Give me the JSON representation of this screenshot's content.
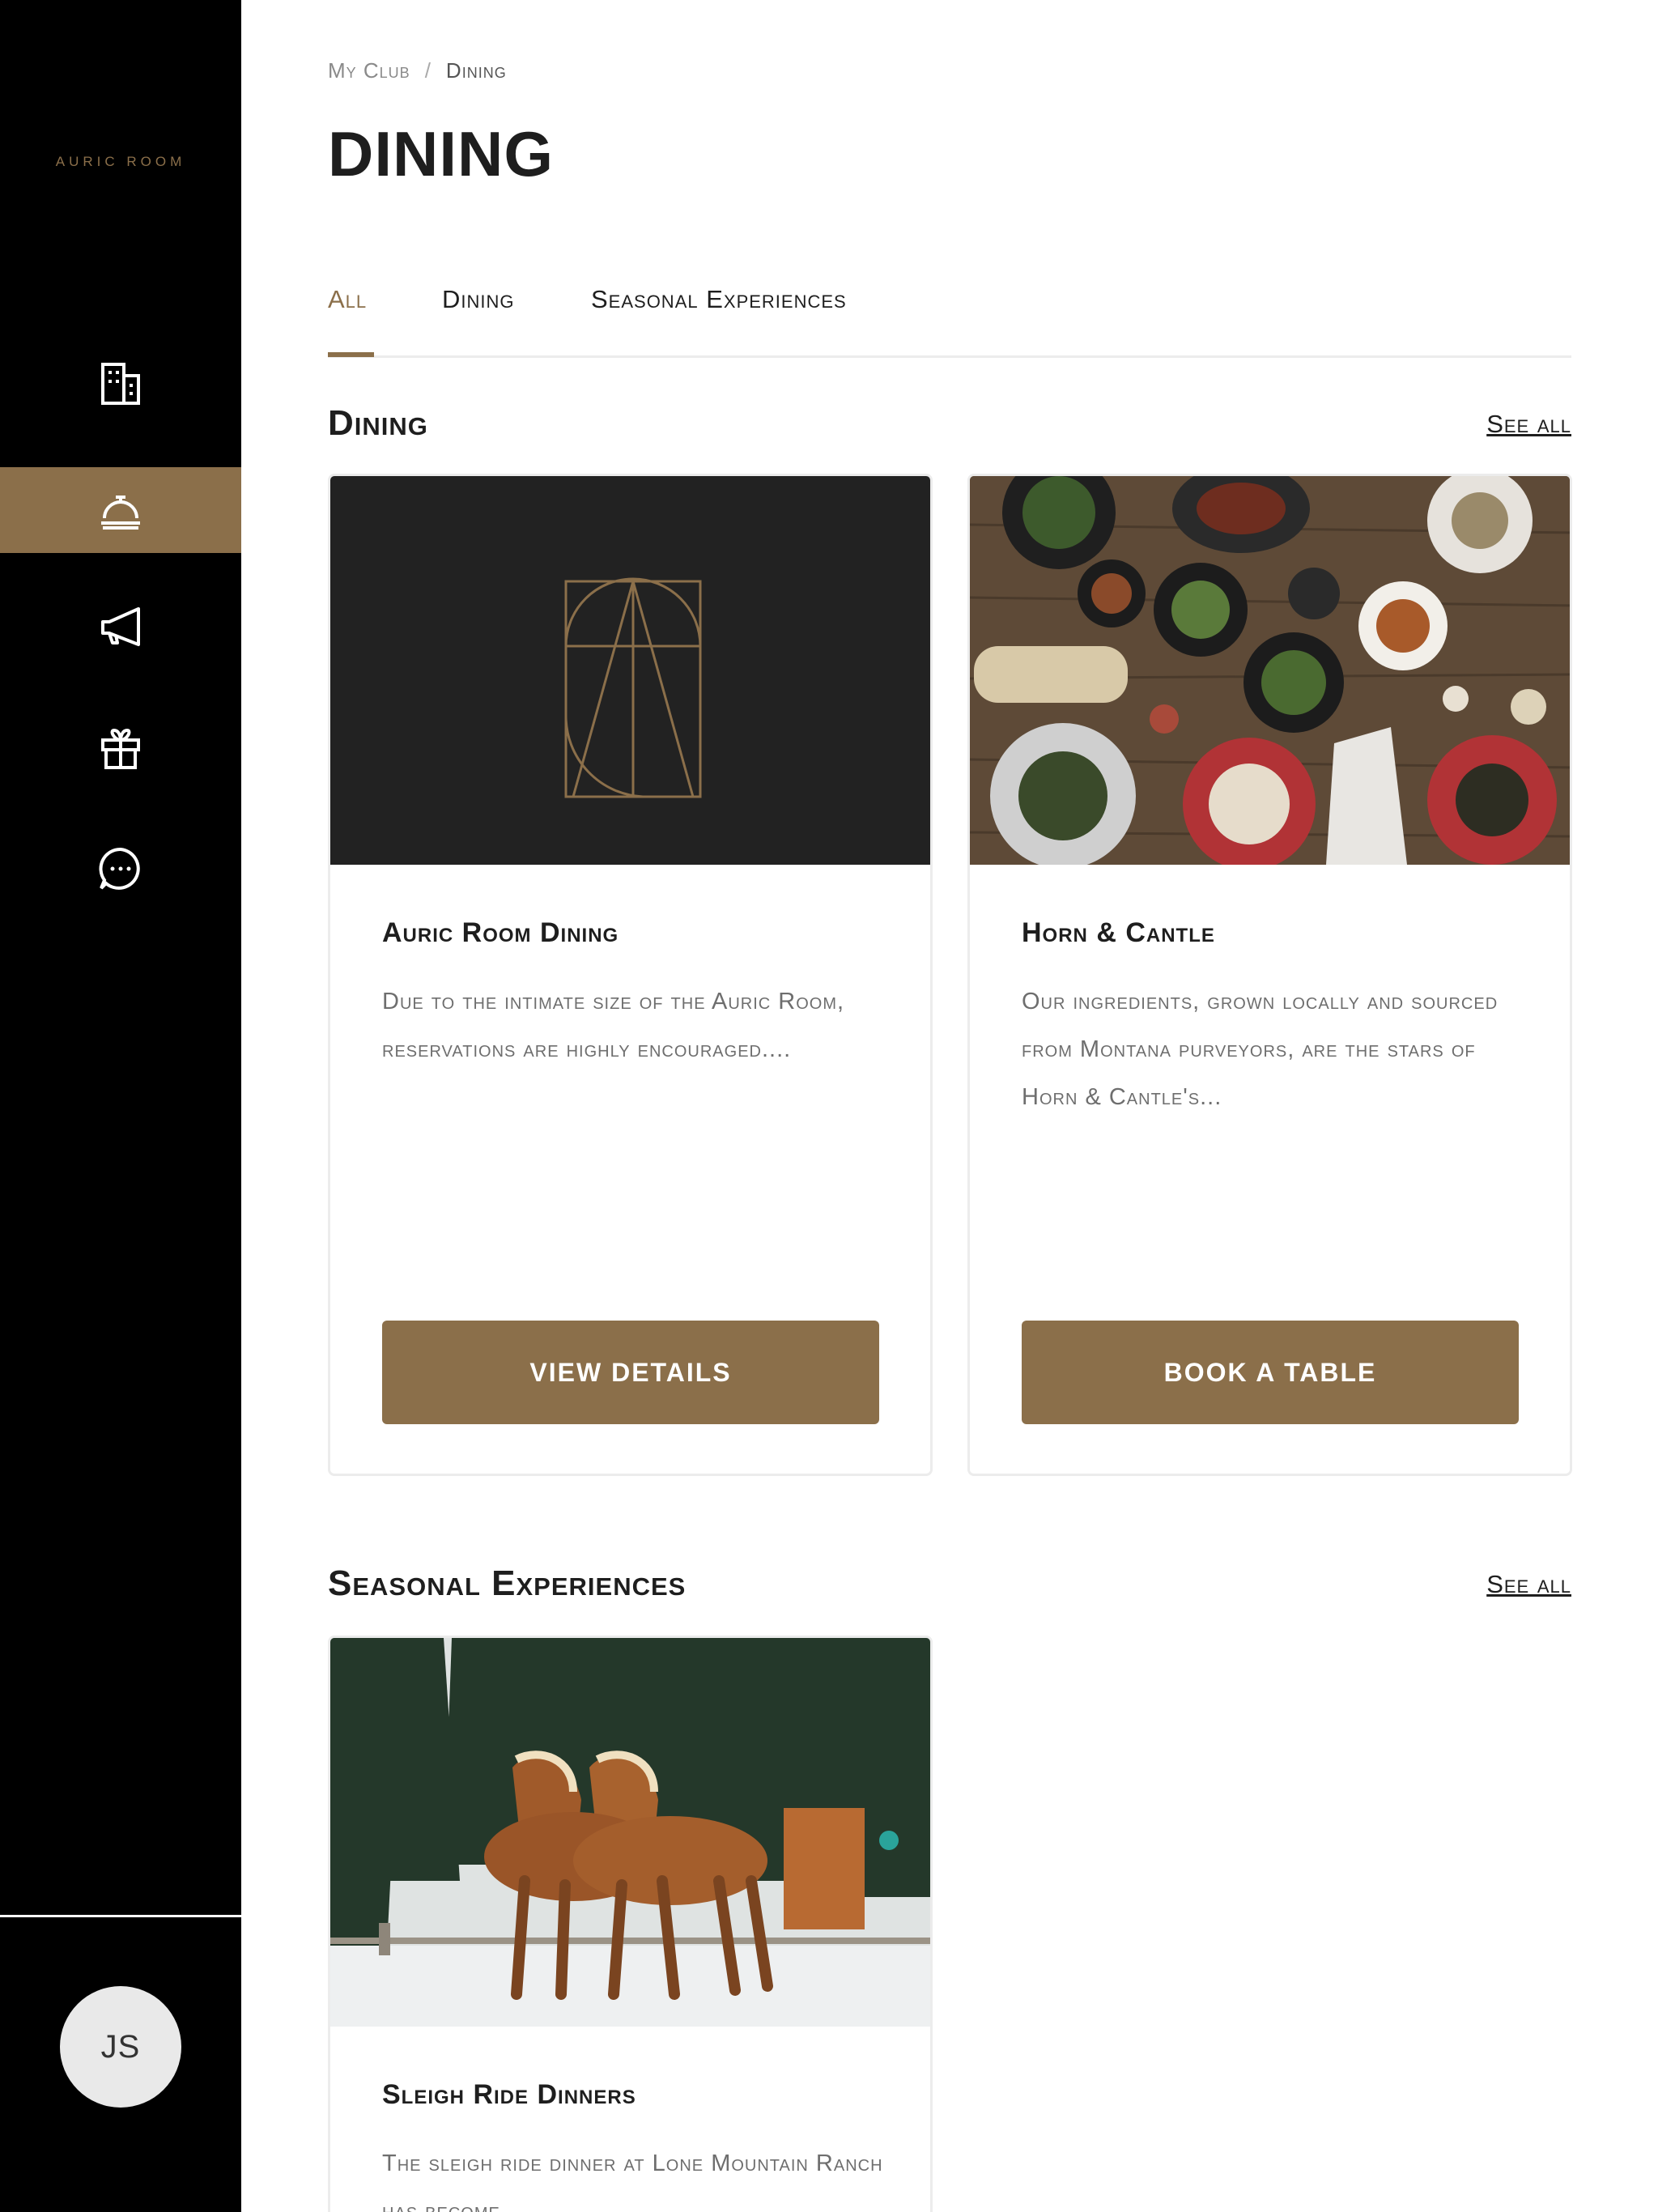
{
  "sidebar": {
    "brand": "AURIC ROOM",
    "items": [
      {
        "name": "building-icon"
      },
      {
        "name": "dining-bell-icon",
        "active": true
      },
      {
        "name": "megaphone-icon"
      },
      {
        "name": "gift-icon"
      },
      {
        "name": "chat-bubble-icon"
      }
    ],
    "user_initials": "JS"
  },
  "breadcrumb": {
    "home": "My Club",
    "separator": "/",
    "current": "Dining"
  },
  "page_title": "DINING",
  "tabs": [
    {
      "label": "All",
      "active": true
    },
    {
      "label": "Dining"
    },
    {
      "label": "Seasonal Experiences"
    }
  ],
  "sections": {
    "dining": {
      "title": "Dining",
      "see_all": "See all",
      "cards": [
        {
          "title": "Auric Room Dining",
          "description": "Due to the intimate size of the Auric Room, reservations are highly encouraged....",
          "button": "VIEW DETAILS",
          "image": "auric-room-logo"
        },
        {
          "title": "Horn & Cantle",
          "description": "Our ingredients, grown locally and sourced from Montana purveyors, are the stars of Horn & Cantle's...",
          "button": "BOOK A TABLE",
          "image": "table-of-dishes-photo"
        }
      ]
    },
    "seasonal": {
      "title": "Seasonal Experiences",
      "see_all": "See all",
      "cards": [
        {
          "title": "Sleigh Ride Dinners",
          "description": "The sleigh ride dinner at Lone Mountain Ranch has become",
          "image": "horse-drawn-sleigh-photo"
        }
      ]
    }
  },
  "colors": {
    "accent": "#8b6f4a",
    "sidebar": "#000000",
    "logo_panel": "#222222"
  }
}
